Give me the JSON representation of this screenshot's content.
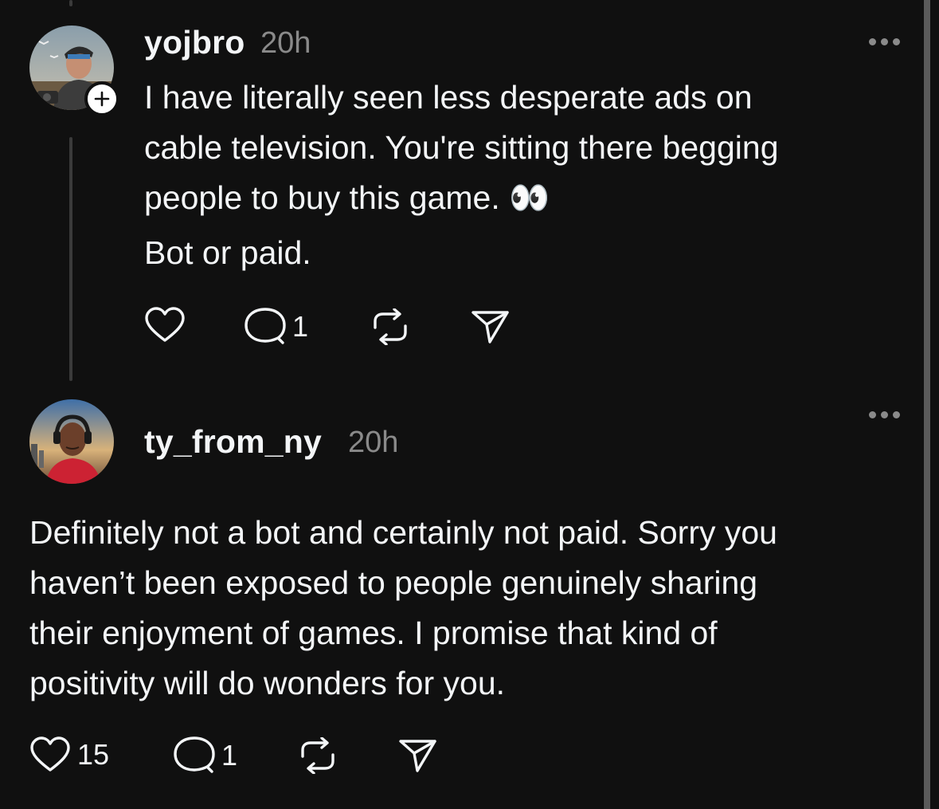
{
  "posts": [
    {
      "username": "yojbro",
      "time": "20h",
      "lines": [
        "I have literally seen less desperate ads on",
        "cable television. You're sitting there begging",
        "people to buy this game. 👀",
        "Bot or paid."
      ],
      "likes": "",
      "replies": "1",
      "follow_badge": "+"
    },
    {
      "username": "ty_from_ny",
      "time": "20h",
      "lines": [
        "Definitely not a bot and certainly not paid. Sorry you",
        "haven’t been exposed to people genuinely sharing",
        "their enjoyment of games. I promise that kind of",
        "positivity will do wonders for you."
      ],
      "likes": "15",
      "replies": "1"
    }
  ],
  "icons": {
    "like": "heart-icon",
    "reply": "comment-icon",
    "repost": "repost-icon",
    "share": "send-icon",
    "more": "more-icon"
  },
  "colors": {
    "background": "#101010",
    "text": "#f3f5f7",
    "muted": "#8a8a8a"
  }
}
